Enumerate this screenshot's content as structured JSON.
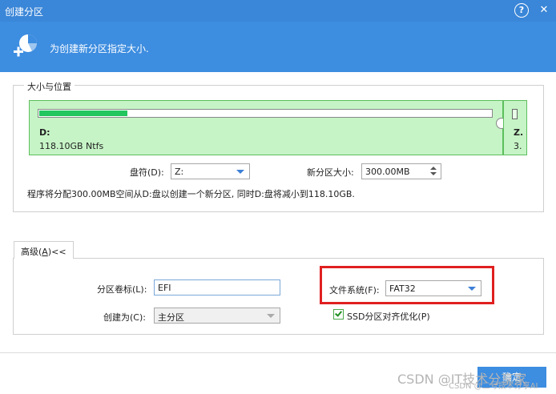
{
  "window": {
    "title": "创建分区",
    "help_glyph": "?",
    "close_glyph": "✕"
  },
  "header": {
    "text": "为创建新分区指定大小."
  },
  "size_group": {
    "legend": "大小与位置",
    "disk": {
      "letter": "D:",
      "info": "118.10GB Ntfs",
      "used_fraction": 0.195
    },
    "new_partition": {
      "letter": "Z.",
      "info": "3."
    },
    "drive_letter_label": "盘符(D):",
    "drive_letter_value": "Z:",
    "new_size_label": "新分区大小:",
    "new_size_value": "300.00MB",
    "description": "程序将分配300.00MB空间从D:盘以创建一个新分区, 同时D:盘将减小到118.10GB."
  },
  "advanced": {
    "tab_label_pre": "高级(",
    "tab_label_key": "A",
    "tab_label_post": ")<<",
    "volume_label": "分区卷标(L):",
    "volume_value": "EFI",
    "create_as_label": "创建为(C):",
    "create_as_value": "主分区",
    "filesystem_label": "文件系统(F):",
    "filesystem_value": "FAT32",
    "ssd_align_label": "SSD分区对齐优化(P)",
    "ssd_align_checked": true
  },
  "footer": {
    "ok_label": "确定",
    "watermark": "CSDN @IT技术分享家",
    "watermark_sub": "CSDN @二号技术分享AI"
  },
  "colors": {
    "titlebar": "#3a86d8",
    "header": "#3d8de0",
    "disk_fill": "#c6f4c6",
    "highlight": "#e02020"
  }
}
